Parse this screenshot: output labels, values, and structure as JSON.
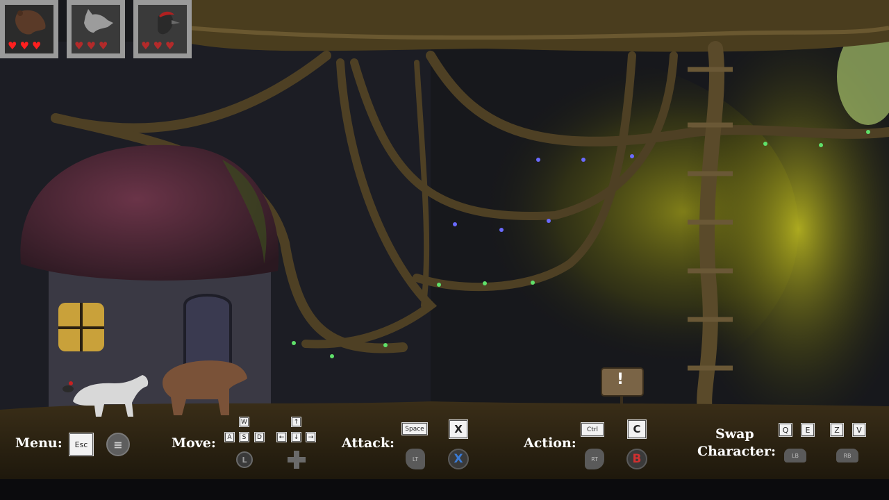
{
  "hud": {
    "characters": [
      {
        "name": "bear",
        "icon": "bear-portrait-icon",
        "hearts": 3,
        "active": true
      },
      {
        "name": "wolf",
        "icon": "wolf-portrait-icon",
        "hearts": 3,
        "active": false
      },
      {
        "name": "woodpecker",
        "icon": "woodpecker-portrait-icon",
        "hearts": 3,
        "active": false
      }
    ],
    "heart_glyph": "♥"
  },
  "controls": {
    "menu": {
      "label": "Menu:",
      "key": "Esc",
      "pad_icon": "menu-lines-icon"
    },
    "move": {
      "label": "Move:",
      "keys_wasd": [
        "W",
        "A",
        "S",
        "D"
      ],
      "keys_arrows": [
        "↑",
        "←",
        "↓",
        "→"
      ],
      "stick": "L",
      "pad_icon": "dpad-icon"
    },
    "attack": {
      "label": "Attack:",
      "key": "Space",
      "pad_key": "X",
      "trigger": "LT",
      "button": "X"
    },
    "action": {
      "label": "Action:",
      "key": "Ctrl",
      "pad_key": "C",
      "trigger": "RT",
      "button": "B"
    },
    "swap": {
      "label_line1": "Swap",
      "label_line2": "Character:",
      "keys": [
        "Q",
        "E",
        "Z",
        "V"
      ],
      "bumpers": [
        "LB",
        "RB"
      ]
    }
  },
  "scene": {
    "sign_glyph": "!",
    "colors": {
      "bar": "#2a2214",
      "vine": "#5a4a2a",
      "glow": "#a59a1c",
      "button_x": "#3a7bd5",
      "button_b": "#d03030",
      "heart": "#ff1f1f"
    }
  }
}
